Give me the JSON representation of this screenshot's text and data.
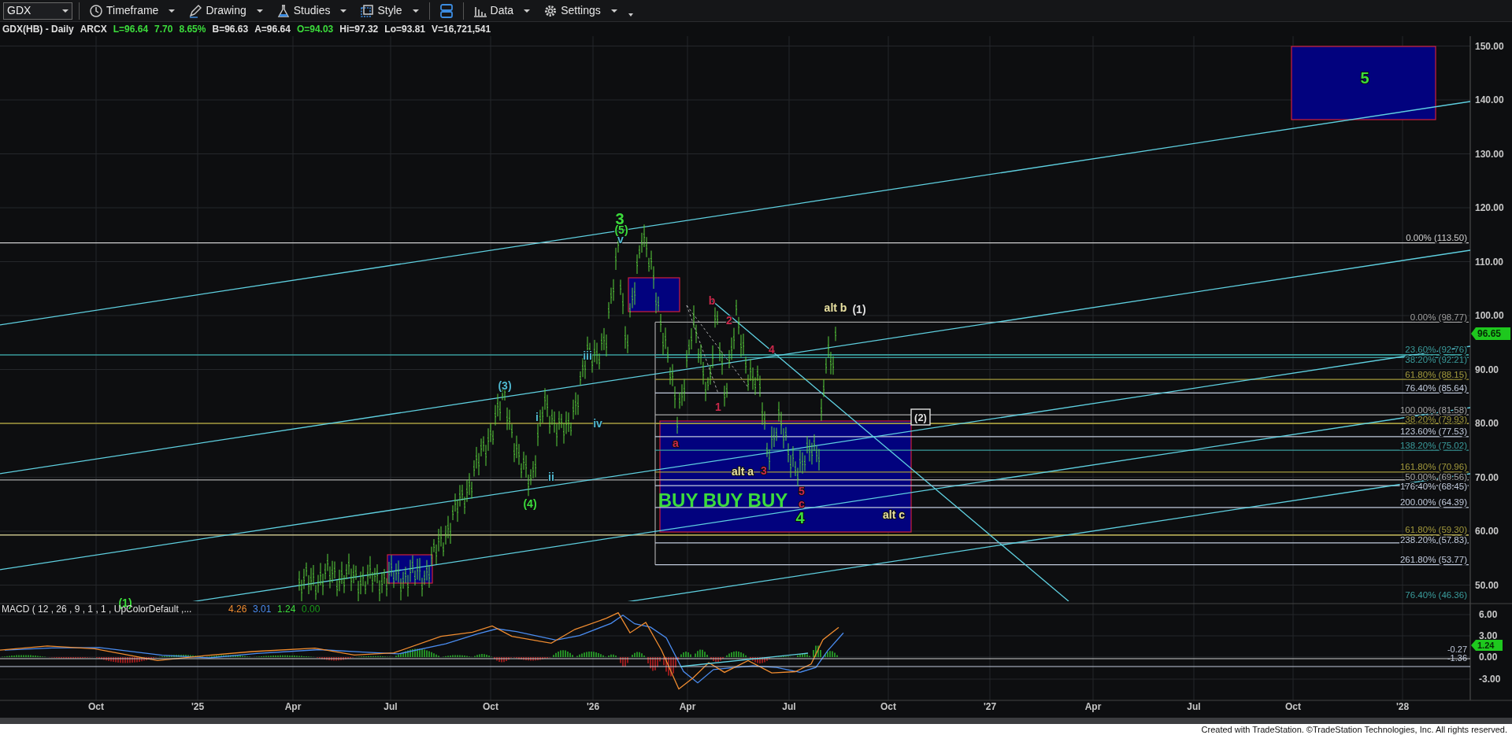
{
  "toolbar": {
    "symbol": "GDX",
    "menus": [
      "Timeframe",
      "Drawing",
      "Studies",
      "Style",
      "Data",
      "Settings"
    ]
  },
  "quote": {
    "title": "GDX(HB) - Daily",
    "exchange": "ARCX",
    "fields": [
      {
        "text": "L=96.64",
        "color": "#3cdc3c"
      },
      {
        "text": "7.70",
        "color": "#3cdc3c"
      },
      {
        "text": "8.65%",
        "color": "#3cdc3c"
      },
      {
        "text": "B=96.63",
        "color": "#e0e0e0"
      },
      {
        "text": "A=96.64",
        "color": "#e0e0e0"
      },
      {
        "text": "O=94.03",
        "color": "#3cdc3c"
      },
      {
        "text": "Hi=97.32",
        "color": "#e0e0e0"
      },
      {
        "text": "Lo=93.81",
        "color": "#e0e0e0"
      },
      {
        "text": "V=16,721,541",
        "color": "#e0e0e0"
      }
    ]
  },
  "price_axis": [
    "150.00",
    "140.00",
    "130.00",
    "120.00",
    "110.00",
    "100.00",
    "90.00",
    "80.00",
    "70.00",
    "60.00",
    "50.00"
  ],
  "last_price": "96.65",
  "fib_levels": [
    {
      "label": "0.00% (113.50)",
      "color": "#cfcfcf"
    },
    {
      "label": "0.00% (98.77)",
      "color": "#a0a0a0"
    },
    {
      "label": "23.60% (92.76)",
      "color": "#3a9c9c"
    },
    {
      "label": "38.20% (92.21)",
      "color": "#3a9c9c"
    },
    {
      "label": "61.80% (88.15)",
      "color": "#a39a3c"
    },
    {
      "label": "76.40% (85.64)",
      "color": "#c2cbdc"
    },
    {
      "label": "100.00% (81.58)",
      "color": "#a8a8a8"
    },
    {
      "label": "38.20% (79.93)",
      "color": "#a39a3c"
    },
    {
      "label": "123.60% (77.53)",
      "color": "#c2cbdc"
    },
    {
      "label": "138.20% (75.02)",
      "color": "#3a9c9c"
    },
    {
      "label": "161.80% (70.96)",
      "color": "#a39a3c"
    },
    {
      "label": "50.00% (69.56)",
      "color": "#a8a8a8"
    },
    {
      "label": "176.40% (68.45)",
      "color": "#c2cbdc"
    },
    {
      "label": "200.00% (64.39)",
      "color": "#c2cbdc"
    },
    {
      "label": "61.80% (59.30)",
      "color": "#a39a3c"
    },
    {
      "label": "238.20% (57.83)",
      "color": "#c2cbdc"
    },
    {
      "label": "261.80% (53.77)",
      "color": "#c2cbdc"
    },
    {
      "label": "76.40% (46.36)",
      "color": "#3a9c9c"
    }
  ],
  "wave_labels": [
    {
      "text": "3",
      "kind": "major",
      "color": "#3cdc3c"
    },
    {
      "text": "(5)",
      "kind": "minor",
      "color": "#3cdc3c"
    },
    {
      "text": "v",
      "kind": "minor",
      "color": "#4fb8d0"
    },
    {
      "text": "iii",
      "kind": "minor",
      "color": "#4fb8d0"
    },
    {
      "text": "iv",
      "kind": "minor",
      "color": "#4fb8d0"
    },
    {
      "text": "i",
      "kind": "minor",
      "color": "#4fb8d0"
    },
    {
      "text": "ii",
      "kind": "minor",
      "color": "#4fb8d0"
    },
    {
      "text": "(3)",
      "kind": "minor",
      "color": "#4fb8d0"
    },
    {
      "text": "(4)",
      "kind": "minor",
      "color": "#3cdc3c"
    },
    {
      "text": "(1)",
      "kind": "minor",
      "color": "#3cdc3c"
    },
    {
      "text": "b",
      "kind": "minor",
      "color": "#c8284a"
    },
    {
      "text": "2",
      "kind": "minor",
      "color": "#c8284a"
    },
    {
      "text": "4",
      "kind": "minor",
      "color": "#c8284a"
    },
    {
      "text": "1",
      "kind": "minor",
      "color": "#c8284a"
    },
    {
      "text": "a",
      "kind": "minor",
      "color": "#c8284a"
    },
    {
      "text": "alt a",
      "kind": "minor",
      "color": "#e8e0a0"
    },
    {
      "text": "3",
      "kind": "minor",
      "color": "#c8284a"
    },
    {
      "text": "5",
      "kind": "minor",
      "color": "#c8284a"
    },
    {
      "text": "BUY BUY BUY",
      "kind": "banner",
      "color": "#3cdc3c"
    },
    {
      "text": "c",
      "kind": "minor",
      "color": "#c8284a"
    },
    {
      "text": "4",
      "kind": "major",
      "color": "#3cdc3c"
    },
    {
      "text": "alt b",
      "kind": "minor",
      "color": "#e8e0a0"
    },
    {
      "text": "(1)",
      "kind": "minor",
      "color": "#e0e0e0"
    },
    {
      "text": "(2)",
      "kind": "boxed",
      "color": "#e0e0e0"
    },
    {
      "text": "alt c",
      "kind": "minor",
      "color": "#e8e0a0"
    },
    {
      "text": "5",
      "kind": "major",
      "color": "#3cdc3c"
    }
  ],
  "macd": {
    "title": "MACD ( 12 , 26 , 9 , 1 , 1 , UpColorDefault ,...",
    "values": [
      {
        "text": "4.26",
        "color": "#f08c30"
      },
      {
        "text": "3.01",
        "color": "#4a8cf0"
      },
      {
        "text": "1.24",
        "color": "#3cdc3c"
      },
      {
        "text": "0.00",
        "color": "#1a9a1a"
      }
    ],
    "axis": [
      "6.00",
      "3.00",
      "0.00",
      "-3.00"
    ],
    "levels": [
      "-0.27",
      "-1.36"
    ],
    "last": "1.24"
  },
  "time_axis": [
    "Oct",
    "'25",
    "Apr",
    "Jul",
    "Oct",
    "'26",
    "Apr",
    "Jul",
    "Oct",
    "'27",
    "Apr",
    "Jul",
    "Oct",
    "'28"
  ],
  "footer": "Created with TradeStation. ©TradeStation Technologies, Inc. All rights reserved."
}
